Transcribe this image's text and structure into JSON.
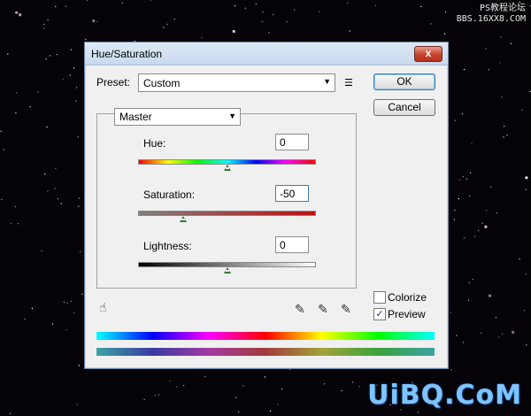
{
  "watermark": {
    "line1": "PS教程论坛",
    "line2": "BBS.16XX8.COM",
    "bottom": "UiBQ.CoM"
  },
  "dialog": {
    "title": "Hue/Saturation",
    "close_label": "x",
    "preset_label": "Preset:",
    "preset_value": "Custom",
    "ok_label": "OK",
    "cancel_label": "Cancel",
    "channel_value": "Master",
    "hue_label": "Hue:",
    "hue_value": "0",
    "saturation_label": "Saturation:",
    "saturation_value": "-50",
    "lightness_label": "Lightness:",
    "lightness_value": "0",
    "colorize_label": "Colorize",
    "colorize_checked": false,
    "preview_label": "Preview",
    "preview_checked": true,
    "preview_check_glyph": "✓"
  },
  "icons": {
    "menu": "preset-options-icon",
    "hand": "targeted-adjustment-icon",
    "eyedropper": "eyedropper-icon",
    "eyedropper_plus": "eyedropper-add-icon",
    "eyedropper_minus": "eyedropper-subtract-icon"
  }
}
